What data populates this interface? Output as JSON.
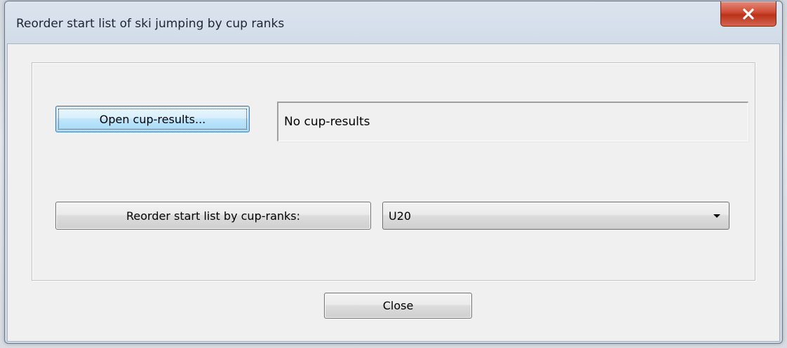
{
  "window": {
    "title": "Reorder start list of ski jumping by cup ranks",
    "close_glyph": "X"
  },
  "main": {
    "open_button_label": "Open cup-results...",
    "cup_results_status": "No cup-results",
    "reorder_button_label": "Reorder start list by cup-ranks:",
    "category_selected": "U20"
  },
  "footer": {
    "close_button_label": "Close"
  },
  "colors": {
    "close_button_red": "#cf4a33",
    "default_button_blue": "#3c7fb1",
    "dialog_background": "#f0f0f0"
  },
  "icons": {
    "title_close": "close-icon",
    "combo_arrow": "chevron-down-icon"
  }
}
